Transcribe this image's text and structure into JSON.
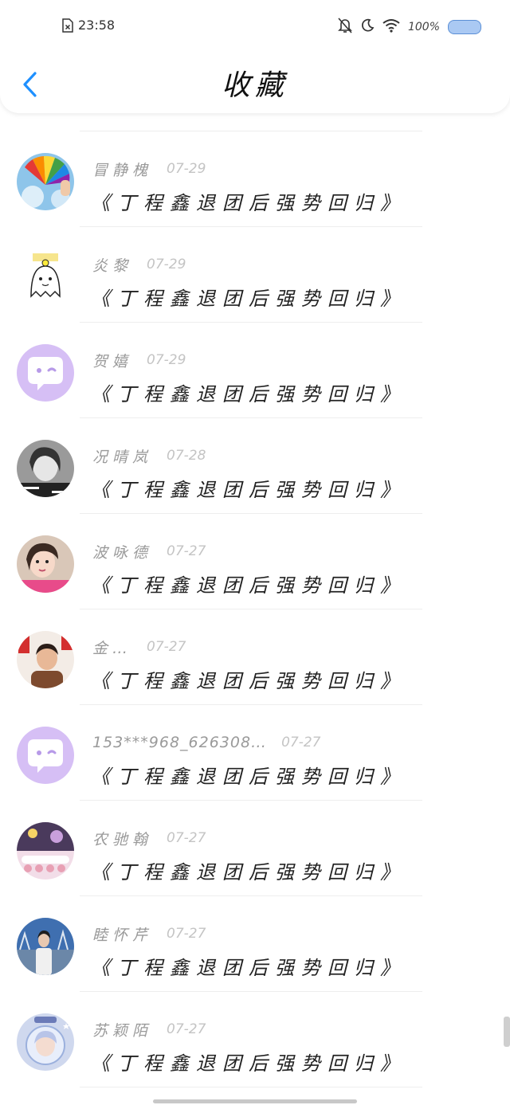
{
  "status_bar": {
    "time": "23:58",
    "battery": "100%",
    "icons": [
      "sim-none-icon",
      "bell-off-icon",
      "moon-icon",
      "wifi-icon",
      "battery-icon"
    ]
  },
  "header": {
    "title": "收藏",
    "back_icon": "chevron-left-icon"
  },
  "accent_color": "#1e90ff",
  "items": [
    {
      "name": "冒静槐",
      "date": "07-29",
      "content": "《丁程鑫退团后强势回归》",
      "avatar": "rainbow-fan"
    },
    {
      "name": "炎黎",
      "date": "07-29",
      "content": "《丁程鑫退团后强势回归》",
      "avatar": "ghost-sticker"
    },
    {
      "name": "贺嬉",
      "date": "07-29",
      "content": "《丁程鑫退团后强势回归》",
      "avatar": "default-chat"
    },
    {
      "name": "况晴岚",
      "date": "07-28",
      "content": "《丁程鑫退团后强势回归》",
      "avatar": "bw-portrait"
    },
    {
      "name": "波咏德",
      "date": "07-27",
      "content": "《丁程鑫退团后强势回归》",
      "avatar": "selfie"
    },
    {
      "name": "金…",
      "date": "07-27",
      "content": "《丁程鑫退团后强势回归》",
      "avatar": "new-year"
    },
    {
      "name": "153***968_626308…",
      "date": "07-27",
      "content": "《丁程鑫退团后强势回归》",
      "avatar": "default-chat"
    },
    {
      "name": "农驰翰",
      "date": "07-27",
      "content": "《丁程鑫退团后强势回归》",
      "avatar": "stage"
    },
    {
      "name": "睦怀芹",
      "date": "07-27",
      "content": "《丁程鑫退团后强势回归》",
      "avatar": "harbor"
    },
    {
      "name": "苏颖陌",
      "date": "07-27",
      "content": "《丁程鑫退团后强势回归》",
      "avatar": "anime-stars"
    }
  ]
}
